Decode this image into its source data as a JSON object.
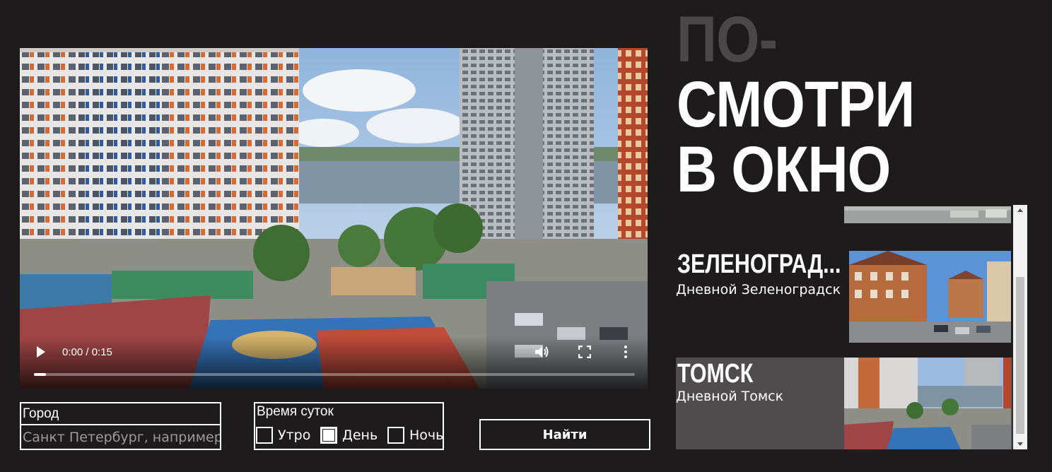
{
  "video": {
    "time_display": "0:00 / 0:15",
    "progress_fraction": 0.02
  },
  "search": {
    "city_label": "Город",
    "city_placeholder": "Санкт Петербург, например",
    "time_label": "Время суток",
    "options": [
      {
        "label": "Утро",
        "checked": false
      },
      {
        "label": "День",
        "checked": true
      },
      {
        "label": "Ночь",
        "checked": false
      }
    ],
    "find_button": "Найти"
  },
  "heading": {
    "line1": "ПО-",
    "line2": "СМОТРИ",
    "line3": "В ОКНО"
  },
  "results": [
    {
      "title": "ЗЕЛЕНОГРАД...",
      "subtitle": "Дневной Зеленоградск"
    },
    {
      "title": "ТОМСК",
      "subtitle": "Дневной Томск"
    }
  ],
  "colors": {
    "background": "#1d1b1c",
    "heading_dim": "#4a4748",
    "selected_card": "#504c4d",
    "placeholder": "#9d9a9b"
  }
}
